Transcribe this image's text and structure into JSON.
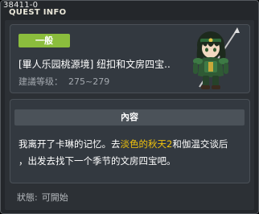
{
  "quest": {
    "id": "38411-0",
    "window_title": "QUEST INFO",
    "category_badge": "一般",
    "name": "[畢人乐园桃源境] 纽扣和文房四宝..",
    "level_label": "建議等级：",
    "level_range": "275~279",
    "content_header": "內容",
    "content_lines": {
      "line1_pre": "我离开了卡琳的记忆。去",
      "line1_highlight": "淡色的秋天2",
      "line1_post": "和伽温交谈后",
      "line2": "，出发去找下一个季节的文房四宝吧。"
    },
    "status_label": "狀態:",
    "status_value": "可開始"
  },
  "colors": {
    "badge_green": "#8bbd3d",
    "highlight_yellow": "#f2c40c",
    "panel_bg": "#333940",
    "window_bg": "#24272b"
  },
  "icons": {
    "npc_portrait": "green-armored-warrior-with-spear"
  }
}
